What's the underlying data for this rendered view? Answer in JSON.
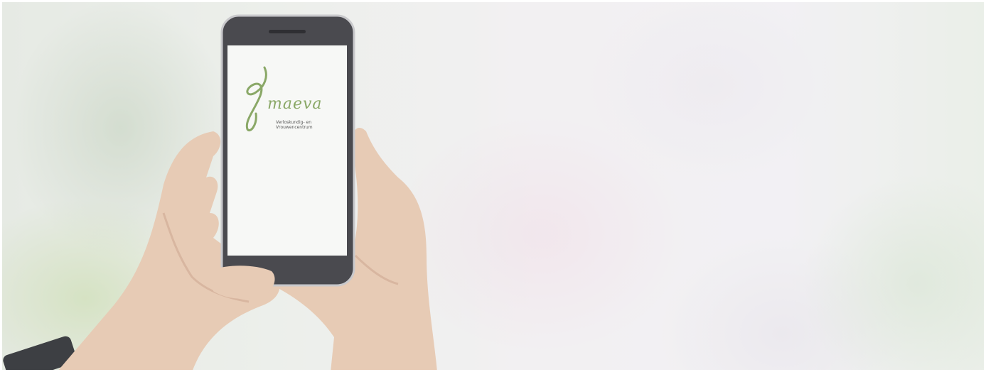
{
  "image": {
    "subject": "hands-holding-phone",
    "colors": {
      "skin": "#e7cbb5",
      "skin_shadow": "#d8b6a0",
      "phone_body": "#4a4a4f",
      "screen": "#f7f8f6",
      "logo_green": "#8aa867",
      "watch": "#3d3f43"
    }
  },
  "app_screen": {
    "brand": "maeva",
    "tagline_line1": "Verloskundig- en",
    "tagline_line2": "Vrouwencentrum"
  }
}
